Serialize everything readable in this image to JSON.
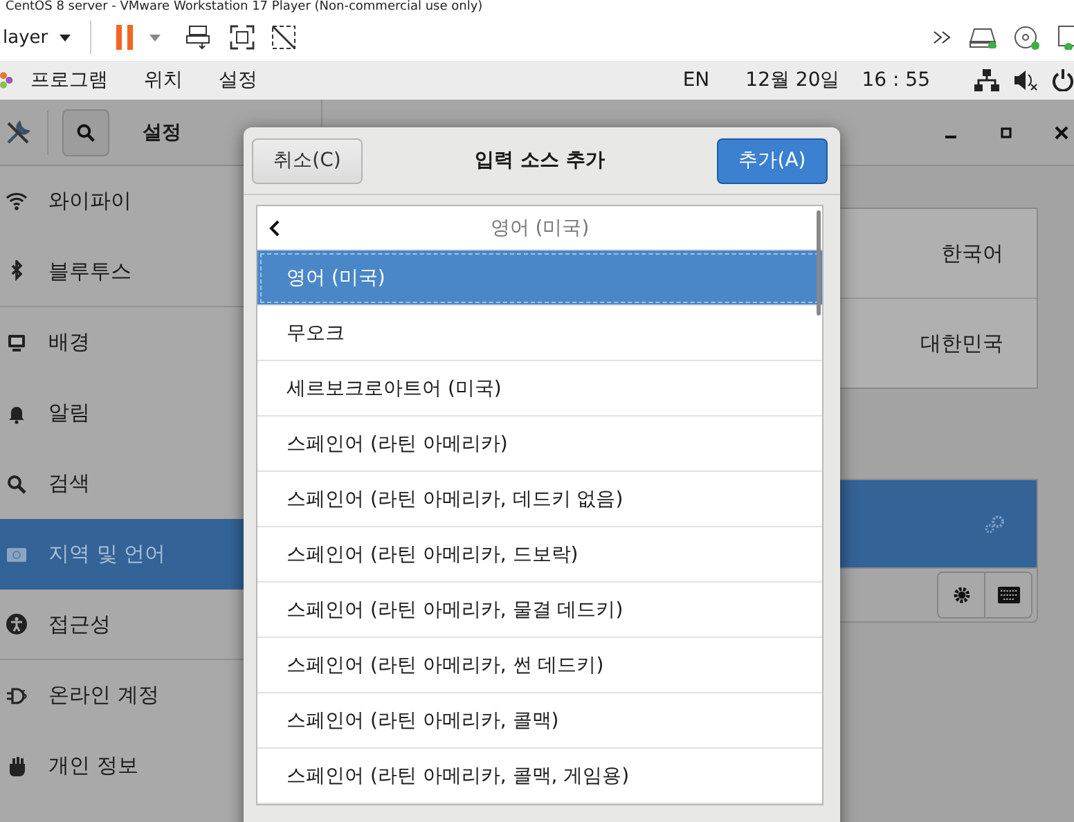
{
  "vm_window": {
    "title": "CentOS 8 server - VMware Workstation 17 Player (Non-commercial use only)",
    "player_menu": "layer"
  },
  "top_bar": {
    "menus": [
      "프로그램",
      "위치",
      "설정"
    ],
    "input_indicator": "EN",
    "date": "12월 20일",
    "time": "16 : 55"
  },
  "settings": {
    "title": "설정",
    "sidebar": [
      {
        "label": "와이파이",
        "selected": false,
        "divider": false
      },
      {
        "label": "블루투스",
        "selected": false,
        "divider": true
      },
      {
        "label": "배경",
        "selected": false,
        "divider": false
      },
      {
        "label": "알림",
        "selected": false,
        "divider": false
      },
      {
        "label": "검색",
        "selected": false,
        "divider": false
      },
      {
        "label": "지역 및 언어",
        "selected": true,
        "divider": false
      },
      {
        "label": "접근성",
        "selected": false,
        "divider": true
      },
      {
        "label": "온라인 계정",
        "selected": false,
        "divider": false
      },
      {
        "label": "개인 정보",
        "selected": false,
        "divider": false
      }
    ],
    "language_rows": [
      "한국어",
      "대한민국"
    ]
  },
  "dialog": {
    "cancel": "취소(C)",
    "title": "입력 소스 추가",
    "add": "추가(A)",
    "header": "영어 (미국)",
    "items": [
      {
        "label": "영어 (미국)",
        "selected": true
      },
      {
        "label": "무오크",
        "selected": false
      },
      {
        "label": "세르보크로아트어 (미국)",
        "selected": false
      },
      {
        "label": "스페인어 (라틴 아메리카)",
        "selected": false
      },
      {
        "label": "스페인어 (라틴 아메리카, 데드키 없음)",
        "selected": false
      },
      {
        "label": "스페인어 (라틴 아메리카, 드보락)",
        "selected": false
      },
      {
        "label": "스페인어 (라틴 아메리카, 물결 데드키)",
        "selected": false
      },
      {
        "label": "스페인어 (라틴 아메리카, 썬 데드키)",
        "selected": false
      },
      {
        "label": "스페인어 (라틴 아메리카, 콜맥)",
        "selected": false
      },
      {
        "label": "스페인어 (라틴 아메리카, 콜맥, 게임용)",
        "selected": false
      }
    ]
  }
}
